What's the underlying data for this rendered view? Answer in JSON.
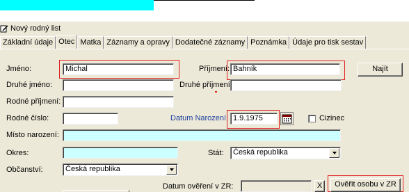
{
  "window": {
    "title": "Nový rodný list"
  },
  "tabs": [
    {
      "label": "Základní údaje"
    },
    {
      "label": "Otec"
    },
    {
      "label": "Matka"
    },
    {
      "label": "Záznamy a opravy"
    },
    {
      "label": "Dodatečné záznamy"
    },
    {
      "label": "Poznámka"
    },
    {
      "label": "Údaje pro tisk sestav"
    }
  ],
  "active_tab": "Otec",
  "form": {
    "jmeno": {
      "label": "Jméno:",
      "value": "Michal"
    },
    "prijmeni": {
      "label": "Příjmení:",
      "value": "Bahník"
    },
    "druhe_jmeno": {
      "label": "Druhé jméno:",
      "value": ""
    },
    "druhe_prijmeni": {
      "label": "Druhé příjmení:",
      "value": ""
    },
    "rodne_prijmeni": {
      "label": "Rodné příjmení:",
      "value": ""
    },
    "rodne_cislo": {
      "label": "Rodné číslo:",
      "value": ""
    },
    "datum_narozeni": {
      "label": "Datum Narození:",
      "value": "1.9.1975"
    },
    "cizinec": {
      "label": "Cizinec",
      "checked": false
    },
    "misto_narozeni": {
      "label": "Místo narození:",
      "value": ""
    },
    "okres": {
      "label": "Okres:",
      "value": ""
    },
    "stat": {
      "label": "Stát:",
      "value": "Česká republika"
    },
    "obcanstvi": {
      "label": "Občanství:",
      "value": "Česká republika"
    },
    "datum_overeni": {
      "label": "Datum ověření v ZR:",
      "value": ""
    }
  },
  "buttons": {
    "najit": "Najít",
    "overit": "Ověřit osobu v ZR",
    "clear": "X"
  },
  "colors": {
    "highlight_red": "#e02020",
    "cyan_field": "#ccffff",
    "top_bar": "#00ffff",
    "label_blue": "#1f3f9f"
  }
}
